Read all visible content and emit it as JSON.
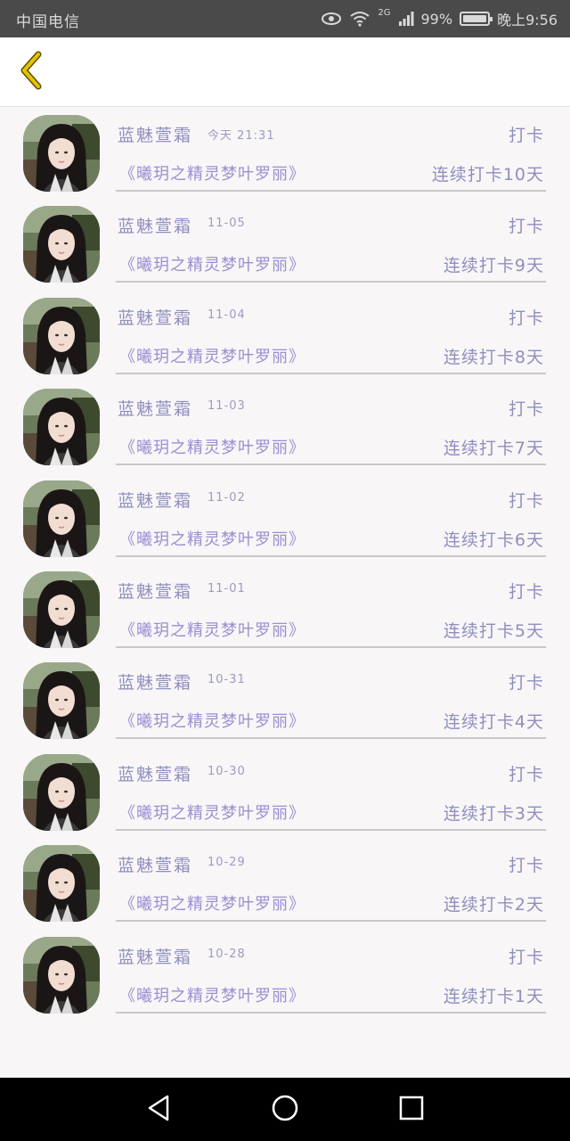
{
  "status_bar": {
    "carrier": "中国电信",
    "network": "2G",
    "battery": "99%",
    "battery_level": 0.99,
    "time": "晚上9:56"
  },
  "header": {
    "back_icon": "chevron-left-icon",
    "accent": "#e6c200"
  },
  "rows": [
    {
      "name": "蓝魅萱霜",
      "date": "今天 21:31",
      "action": "打卡",
      "book": "《曦玥之精灵梦叶罗丽》",
      "streak": "连续打卡10天"
    },
    {
      "name": "蓝魅萱霜",
      "date": "11-05",
      "action": "打卡",
      "book": "《曦玥之精灵梦叶罗丽》",
      "streak": "连续打卡9天"
    },
    {
      "name": "蓝魅萱霜",
      "date": "11-04",
      "action": "打卡",
      "book": "《曦玥之精灵梦叶罗丽》",
      "streak": "连续打卡8天"
    },
    {
      "name": "蓝魅萱霜",
      "date": "11-03",
      "action": "打卡",
      "book": "《曦玥之精灵梦叶罗丽》",
      "streak": "连续打卡7天"
    },
    {
      "name": "蓝魅萱霜",
      "date": "11-02",
      "action": "打卡",
      "book": "《曦玥之精灵梦叶罗丽》",
      "streak": "连续打卡6天"
    },
    {
      "name": "蓝魅萱霜",
      "date": "11-01",
      "action": "打卡",
      "book": "《曦玥之精灵梦叶罗丽》",
      "streak": "连续打卡5天"
    },
    {
      "name": "蓝魅萱霜",
      "date": "10-31",
      "action": "打卡",
      "book": "《曦玥之精灵梦叶罗丽》",
      "streak": "连续打卡4天"
    },
    {
      "name": "蓝魅萱霜",
      "date": "10-30",
      "action": "打卡",
      "book": "《曦玥之精灵梦叶罗丽》",
      "streak": "连续打卡3天"
    },
    {
      "name": "蓝魅萱霜",
      "date": "10-29",
      "action": "打卡",
      "book": "《曦玥之精灵梦叶罗丽》",
      "streak": "连续打卡2天"
    },
    {
      "name": "蓝魅萱霜",
      "date": "10-28",
      "action": "打卡",
      "book": "《曦玥之精灵梦叶罗丽》",
      "streak": "连续打卡1天"
    }
  ],
  "nav_bar": {
    "back_icon": "triangle-back-icon",
    "home_icon": "circle-home-icon",
    "recents_icon": "square-recents-icon"
  }
}
